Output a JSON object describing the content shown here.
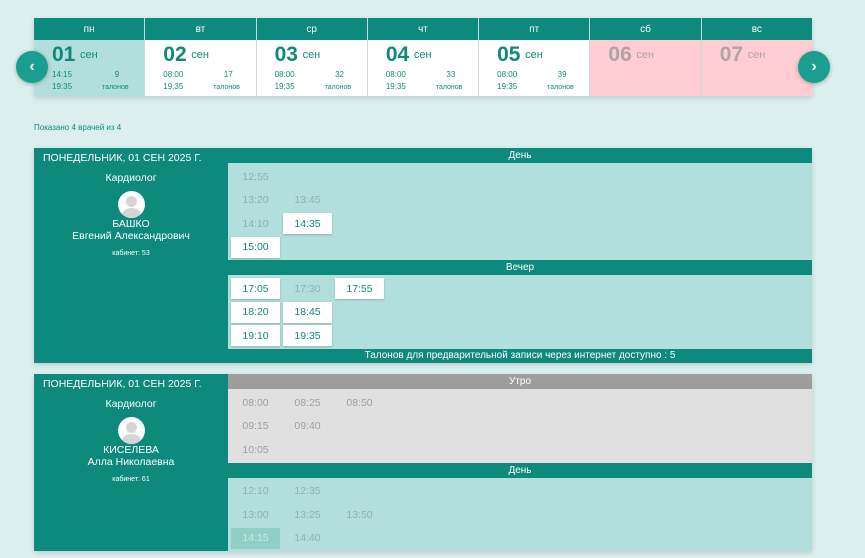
{
  "week": [
    {
      "dow": "пн",
      "day": "01",
      "month": "сен",
      "from": "14:15",
      "to": "19:35",
      "count": "9",
      "label": "талонов",
      "state": "active"
    },
    {
      "dow": "вт",
      "day": "02",
      "month": "сен",
      "from": "08:00",
      "to": "19:35",
      "count": "17",
      "label": "талонов",
      "state": "normal"
    },
    {
      "dow": "ср",
      "day": "03",
      "month": "сен",
      "from": "08:00",
      "to": "19:35",
      "count": "32",
      "label": "талонов",
      "state": "normal"
    },
    {
      "dow": "чт",
      "day": "04",
      "month": "сен",
      "from": "08:00",
      "to": "19:35",
      "count": "33",
      "label": "талонов",
      "state": "normal"
    },
    {
      "dow": "пт",
      "day": "05",
      "month": "сен",
      "from": "08:00",
      "to": "19:35",
      "count": "39",
      "label": "талонов",
      "state": "normal"
    },
    {
      "dow": "сб",
      "day": "06",
      "month": "сен",
      "from": "",
      "to": "",
      "count": "",
      "label": "",
      "state": "weekend"
    },
    {
      "dow": "вс",
      "day": "07",
      "month": "сен",
      "from": "",
      "to": "",
      "count": "",
      "label": "",
      "state": "weekend"
    }
  ],
  "nav": {
    "prev_icon": "chevron-left-icon",
    "next_icon": "chevron-right-icon",
    "prev_glyph": "‹",
    "next_glyph": "›"
  },
  "shown_text": "Показано 4 врачей из 4",
  "doctors": [
    {
      "date": "ПОНЕДЕЛЬНИК, 01 СЕН 2025 Г.",
      "specialty": "Кардиолог",
      "surname": "БАШКО",
      "name": "Евгений Александрович",
      "cabinet": "кабинет: 53",
      "sections": [
        {
          "title": "День",
          "grey": false,
          "rows": [
            [
              {
                "t": "12:55",
                "s": "taken"
              }
            ],
            [
              {
                "t": "13:20",
                "s": "taken"
              },
              {
                "t": "13:45",
                "s": "taken"
              }
            ],
            [
              {
                "t": "14:10",
                "s": "taken"
              },
              {
                "t": "14:35",
                "s": "free"
              }
            ],
            [
              {
                "t": "15:00",
                "s": "free"
              }
            ]
          ]
        },
        {
          "title": "Вечер",
          "grey": false,
          "rows": [
            [
              {
                "t": "17:05",
                "s": "free"
              },
              {
                "t": "17:30",
                "s": "taken"
              },
              {
                "t": "17:55",
                "s": "free"
              }
            ],
            [
              {
                "t": "18:20",
                "s": "free"
              },
              {
                "t": "18:45",
                "s": "free"
              }
            ],
            [
              {
                "t": "19:10",
                "s": "free"
              },
              {
                "t": "19:35",
                "s": "free"
              }
            ]
          ]
        }
      ],
      "footer": "Талонов для предварительной записи через интернет доступно : 5"
    },
    {
      "date": "ПОНЕДЕЛЬНИК, 01 СЕН 2025 Г.",
      "specialty": "Кардиолог",
      "surname": "КИСЕЛЕВА",
      "name": "Алла Николаевна",
      "cabinet": "кабинет: 61",
      "sections": [
        {
          "title": "Утро",
          "grey": true,
          "rows": [
            [
              {
                "t": "08:00",
                "s": "taken"
              },
              {
                "t": "08:25",
                "s": "taken"
              },
              {
                "t": "08:50",
                "s": "taken"
              }
            ],
            [
              {
                "t": "09:15",
                "s": "taken"
              },
              {
                "t": "09:40",
                "s": "taken"
              }
            ],
            [
              {
                "t": "10:05",
                "s": "taken"
              }
            ]
          ]
        },
        {
          "title": "День",
          "grey": false,
          "rows": [
            [
              {
                "t": "12:10",
                "s": "taken"
              },
              {
                "t": "12:35",
                "s": "taken"
              }
            ],
            [
              {
                "t": "13:00",
                "s": "taken"
              },
              {
                "t": "13:25",
                "s": "taken"
              },
              {
                "t": "13:50",
                "s": "taken"
              }
            ],
            [
              {
                "t": "14:15",
                "s": "sel"
              },
              {
                "t": "14:40",
                "s": "taken"
              }
            ]
          ]
        }
      ],
      "footer": ""
    }
  ]
}
